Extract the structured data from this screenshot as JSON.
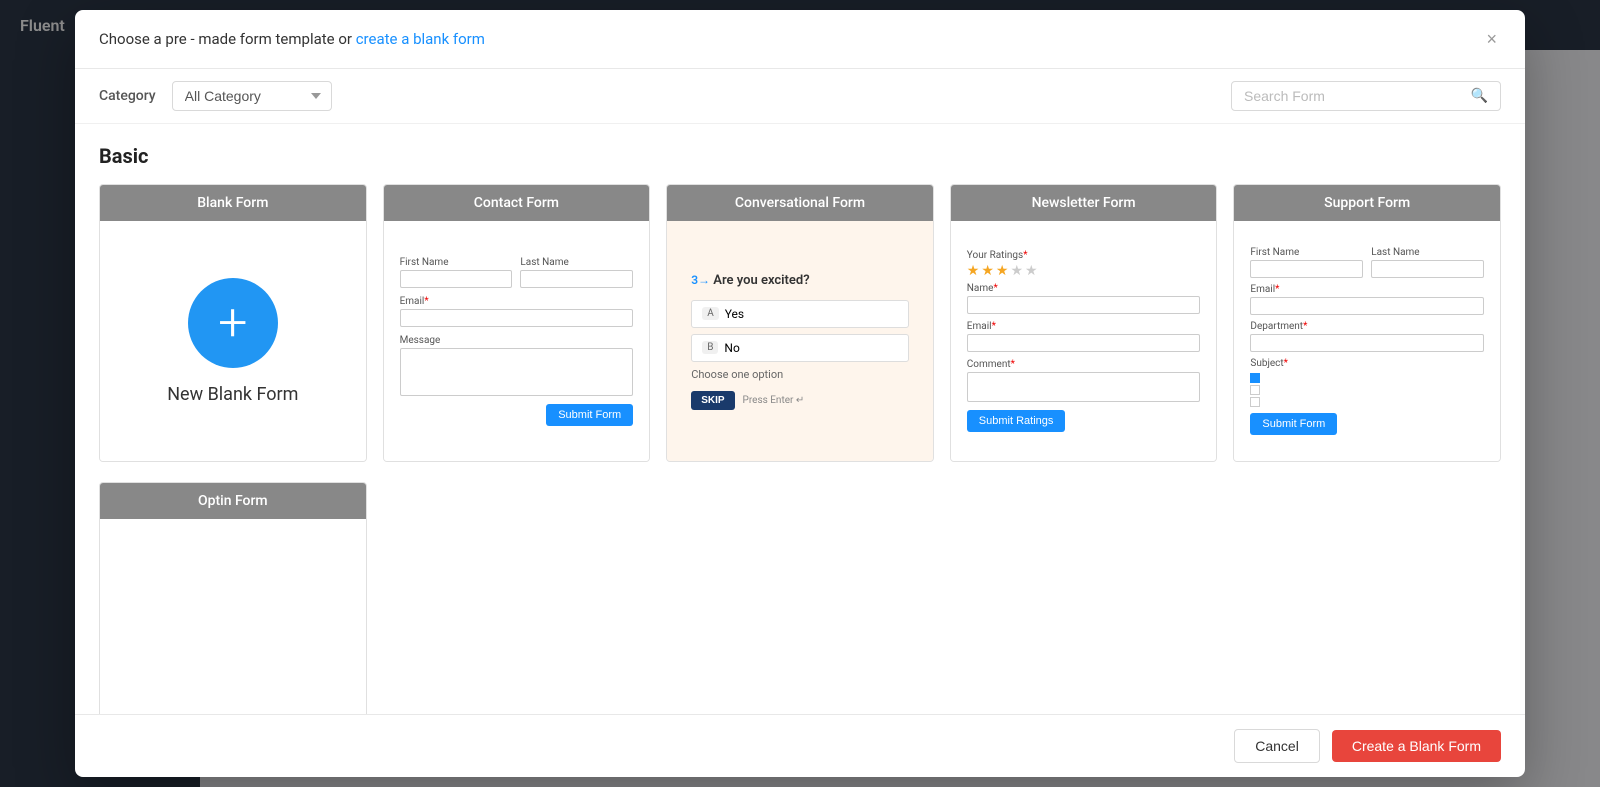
{
  "page": {
    "bg_title": "Fluent"
  },
  "modal": {
    "header_text": "Choose a pre - made form template or ",
    "header_link_text": "create a blank form",
    "close_icon": "×",
    "category_label": "Category",
    "category_default": "All Category",
    "search_placeholder": "Search Form",
    "section_basic_title": "Basic",
    "templates": [
      {
        "id": "blank-form",
        "header": "Blank Form",
        "type": "blank",
        "label": "New Blank Form"
      },
      {
        "id": "contact-form",
        "header": "Contact Form",
        "type": "contact"
      },
      {
        "id": "conversational-form",
        "header": "Conversational Form",
        "type": "conversational"
      },
      {
        "id": "newsletter-form",
        "header": "Newsletter Form",
        "type": "newsletter"
      },
      {
        "id": "support-form",
        "header": "Support Form",
        "type": "support"
      }
    ],
    "templates_row2": [
      {
        "id": "optin-form",
        "header": "Optin Form",
        "type": "optin"
      }
    ],
    "contact_fields": {
      "first_name_label": "First Name",
      "last_name_label": "Last Name",
      "email_label": "Email",
      "message_label": "Message",
      "submit_label": "Submit Form"
    },
    "conv_fields": {
      "step": "3→",
      "question": "Are you excited?",
      "option_a_key": "A",
      "option_a_label": "Yes",
      "option_b_key": "B",
      "option_b_label": "No",
      "hint": "Choose one option",
      "skip_label": "SKIP",
      "press_enter": "Press Enter ↵"
    },
    "newsletter_fields": {
      "ratings_label": "Your Ratings",
      "name_label": "Name",
      "email_label": "Email",
      "comment_label": "Comment",
      "submit_label": "Submit Ratings",
      "stars": [
        true,
        true,
        true,
        false,
        false
      ]
    },
    "support_fields": {
      "first_name_label": "First Name",
      "last_name_label": "Last Name",
      "email_label": "Email",
      "department_label": "Department",
      "subject_label": "Subject",
      "submit_label": "Submit Form",
      "checkboxes": [
        {
          "checked": true,
          "label": ""
        },
        {
          "checked": false,
          "label": ""
        },
        {
          "checked": false,
          "label": ""
        }
      ]
    },
    "footer": {
      "cancel_label": "Cancel",
      "create_blank_label": "Create a Blank Form"
    }
  }
}
